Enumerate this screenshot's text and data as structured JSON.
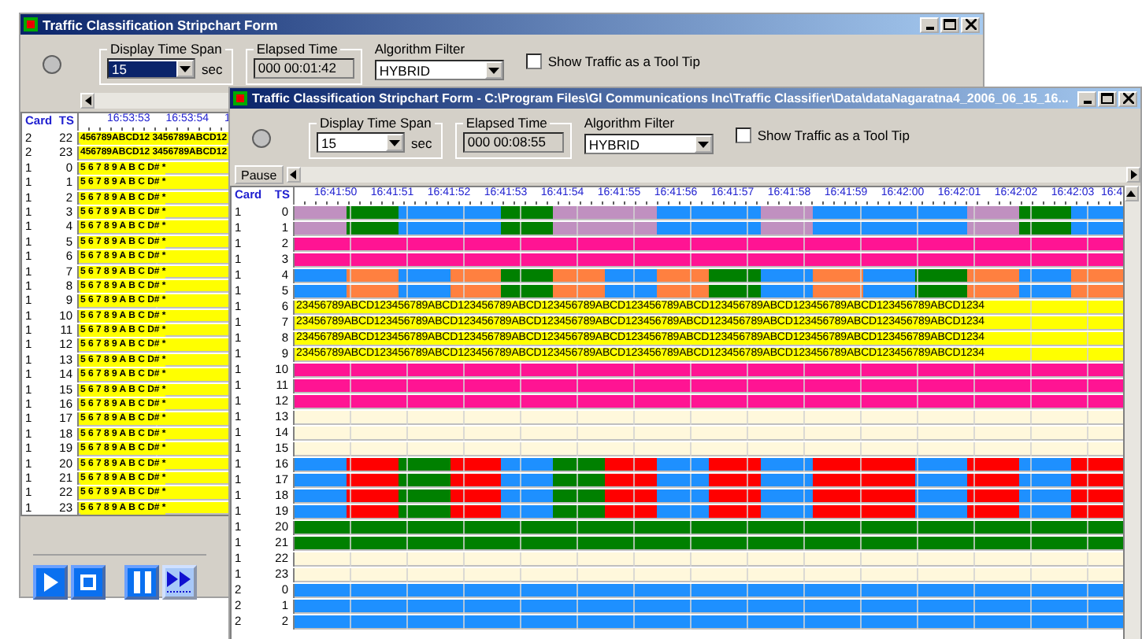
{
  "windows": [
    {
      "title": "Traffic Classification Stripchart Form",
      "time_span": {
        "legend": "Display Time Span",
        "value": "15",
        "highlighted": true,
        "unit": "sec"
      },
      "elapsed": {
        "legend": "Elapsed Time",
        "value": "000 00:01:42"
      },
      "algorithm": {
        "label": "Algorithm Filter",
        "value": "HYBRID"
      },
      "tooltip": {
        "label": "Show Traffic as a Tool Tip",
        "checked": false
      },
      "grid": {
        "columns": [
          "Card",
          "TS"
        ],
        "times": [
          "16:53:53",
          "16:53:54",
          "1"
        ],
        "rows": [
          {
            "card": "2",
            "ts": "22",
            "segments": [
              {
                "color": "#ffff00"
              }
            ],
            "text": "456789ABCD12 3456789ABCD12"
          },
          {
            "card": "2",
            "ts": "23",
            "segments": [
              {
                "color": "#ffff00"
              }
            ],
            "text": "456789ABCD12 3456789ABCD12"
          },
          {
            "card": "1",
            "ts": "0",
            "segments": [
              {
                "color": "#ffff00"
              }
            ],
            "text": "5 6 7 8 9 A B C D# *"
          },
          {
            "card": "1",
            "ts": "1",
            "segments": [
              {
                "color": "#ffff00"
              }
            ],
            "text": "5 6 7 8 9 A B C D# *"
          },
          {
            "card": "1",
            "ts": "2",
            "segments": [
              {
                "color": "#ffff00"
              }
            ],
            "text": "5 6 7 8 9 A B C D# *"
          },
          {
            "card": "1",
            "ts": "3",
            "segments": [
              {
                "color": "#ffff00"
              }
            ],
            "text": "5 6 7 8 9 A B C D# *"
          },
          {
            "card": "1",
            "ts": "4",
            "segments": [
              {
                "color": "#ffff00"
              }
            ],
            "text": "5 6 7 8 9 A B C D# *"
          },
          {
            "card": "1",
            "ts": "5",
            "segments": [
              {
                "color": "#ffff00"
              }
            ],
            "text": "5 6 7 8 9 A B C D# *"
          },
          {
            "card": "1",
            "ts": "6",
            "segments": [
              {
                "color": "#ffff00"
              }
            ],
            "text": "5 6 7 8 9 A B C D# *"
          },
          {
            "card": "1",
            "ts": "7",
            "segments": [
              {
                "color": "#ffff00"
              }
            ],
            "text": "5 6 7 8 9 A B C D# *"
          },
          {
            "card": "1",
            "ts": "8",
            "segments": [
              {
                "color": "#ffff00"
              }
            ],
            "text": "5 6 7 8 9 A B C D# *"
          },
          {
            "card": "1",
            "ts": "9",
            "segments": [
              {
                "color": "#ffff00"
              }
            ],
            "text": "5 6 7 8 9 A B C D# *"
          },
          {
            "card": "1",
            "ts": "10",
            "segments": [
              {
                "color": "#ffff00"
              }
            ],
            "text": "5 6 7 8 9 A B C D# *"
          },
          {
            "card": "1",
            "ts": "11",
            "segments": [
              {
                "color": "#ffff00"
              }
            ],
            "text": "5 6 7 8 9 A B C D# *"
          },
          {
            "card": "1",
            "ts": "12",
            "segments": [
              {
                "color": "#ffff00"
              }
            ],
            "text": "5 6 7 8 9 A B C D# *"
          },
          {
            "card": "1",
            "ts": "13",
            "segments": [
              {
                "color": "#ffff00"
              }
            ],
            "text": "5 6 7 8 9 A B C D# *"
          },
          {
            "card": "1",
            "ts": "14",
            "segments": [
              {
                "color": "#ffff00"
              }
            ],
            "text": "5 6 7 8 9 A B C D# *"
          },
          {
            "card": "1",
            "ts": "15",
            "segments": [
              {
                "color": "#ffff00"
              }
            ],
            "text": "5 6 7 8 9 A B C D# *"
          },
          {
            "card": "1",
            "ts": "16",
            "segments": [
              {
                "color": "#ffff00"
              }
            ],
            "text": "5 6 7 8 9 A B C D# *"
          },
          {
            "card": "1",
            "ts": "17",
            "segments": [
              {
                "color": "#ffff00"
              }
            ],
            "text": "5 6 7 8 9 A B C D# *"
          },
          {
            "card": "1",
            "ts": "18",
            "segments": [
              {
                "color": "#ffff00"
              }
            ],
            "text": "5 6 7 8 9 A B C D# *"
          },
          {
            "card": "1",
            "ts": "19",
            "segments": [
              {
                "color": "#ffff00"
              }
            ],
            "text": "5 6 7 8 9 A B C D# *"
          },
          {
            "card": "1",
            "ts": "20",
            "segments": [
              {
                "color": "#ffff00"
              }
            ],
            "text": "5 6 7 8 9 A B C D# *"
          },
          {
            "card": "1",
            "ts": "21",
            "segments": [
              {
                "color": "#ffff00"
              }
            ],
            "text": "5 6 7 8 9 A B C D# *"
          },
          {
            "card": "1",
            "ts": "22",
            "segments": [
              {
                "color": "#ffff00"
              }
            ],
            "text": "5 6 7 8 9 A B C D# *"
          },
          {
            "card": "1",
            "ts": "23",
            "segments": [
              {
                "color": "#ffff00"
              }
            ],
            "text": "5 6 7 8 9 A B C D# *"
          }
        ]
      },
      "transport": [
        {
          "kind": "play",
          "selected": false
        },
        {
          "kind": "stop",
          "selected": false
        },
        {
          "kind": "pause",
          "selected": false
        },
        {
          "kind": "fast-forward",
          "selected": true
        }
      ]
    },
    {
      "title": "Traffic Classification Stripchart Form - C:\\Program Files\\Gl Communications Inc\\Traffic Classifier\\Data\\dataNagaratna4_2006_06_15_16...",
      "time_span": {
        "legend": "Display Time Span",
        "value": "15",
        "highlighted": false,
        "unit": "sec"
      },
      "elapsed": {
        "legend": "Elapsed Time",
        "value": "000 00:08:55"
      },
      "algorithm": {
        "label": "Algorithm Filter",
        "value": "HYBRID"
      },
      "tooltip": {
        "label": "Show Traffic as a Tool Tip",
        "checked": false
      },
      "pause_label": "Pause",
      "grid": {
        "columns": [
          "Card",
          "TS"
        ],
        "times": [
          "16:41:50",
          "16:41:51",
          "16:41:52",
          "16:41:53",
          "16:41:54",
          "16:41:55",
          "16:41:56",
          "16:41:57",
          "16:41:58",
          "16:41:59",
          "16:42:00",
          "16:42:01",
          "16:42:02",
          "16:42:03",
          "16:4"
        ],
        "rows": [
          {
            "card": "1",
            "ts": "0",
            "segments": [
              {
                "color": "#c090c0"
              },
              {
                "color": "#008000"
              },
              {
                "color": "#1e90ff"
              },
              {
                "color": "#1e90ff"
              },
              {
                "color": "#008000"
              },
              {
                "color": "#c090c0"
              },
              {
                "color": "#c090c0"
              },
              {
                "color": "#1e90ff"
              },
              {
                "color": "#1e90ff"
              },
              {
                "color": "#c090c0"
              },
              {
                "color": "#1e90ff"
              },
              {
                "color": "#1e90ff"
              },
              {
                "color": "#1e90ff"
              },
              {
                "color": "#c090c0"
              },
              {
                "color": "#008000"
              },
              {
                "color": "#1e90ff"
              }
            ]
          },
          {
            "card": "1",
            "ts": "1",
            "segments": [
              {
                "color": "#c090c0"
              },
              {
                "color": "#008000"
              },
              {
                "color": "#1e90ff"
              },
              {
                "color": "#1e90ff"
              },
              {
                "color": "#008000"
              },
              {
                "color": "#c090c0"
              },
              {
                "color": "#c090c0"
              },
              {
                "color": "#1e90ff"
              },
              {
                "color": "#1e90ff"
              },
              {
                "color": "#c090c0"
              },
              {
                "color": "#1e90ff"
              },
              {
                "color": "#1e90ff"
              },
              {
                "color": "#1e90ff"
              },
              {
                "color": "#c090c0"
              },
              {
                "color": "#008000"
              },
              {
                "color": "#1e90ff"
              }
            ]
          },
          {
            "card": "1",
            "ts": "2",
            "segments": [
              {
                "color": "#ff1493"
              }
            ]
          },
          {
            "card": "1",
            "ts": "3",
            "segments": [
              {
                "color": "#ff1493"
              }
            ]
          },
          {
            "card": "1",
            "ts": "4",
            "segments": [
              {
                "color": "#1e90ff"
              },
              {
                "color": "#ff8040"
              },
              {
                "color": "#1e90ff"
              },
              {
                "color": "#ff8040"
              },
              {
                "color": "#008000"
              },
              {
                "color": "#ff8040"
              },
              {
                "color": "#1e90ff"
              },
              {
                "color": "#ff8040"
              },
              {
                "color": "#008000"
              },
              {
                "color": "#1e90ff"
              },
              {
                "color": "#ff8040"
              },
              {
                "color": "#1e90ff"
              },
              {
                "color": "#008000"
              },
              {
                "color": "#ff8040"
              },
              {
                "color": "#1e90ff"
              },
              {
                "color": "#ff8040"
              }
            ]
          },
          {
            "card": "1",
            "ts": "5",
            "segments": [
              {
                "color": "#1e90ff"
              },
              {
                "color": "#ff8040"
              },
              {
                "color": "#1e90ff"
              },
              {
                "color": "#ff8040"
              },
              {
                "color": "#008000"
              },
              {
                "color": "#ff8040"
              },
              {
                "color": "#1e90ff"
              },
              {
                "color": "#ff8040"
              },
              {
                "color": "#008000"
              },
              {
                "color": "#1e90ff"
              },
              {
                "color": "#ff8040"
              },
              {
                "color": "#1e90ff"
              },
              {
                "color": "#008000"
              },
              {
                "color": "#ff8040"
              },
              {
                "color": "#1e90ff"
              },
              {
                "color": "#ff8040"
              }
            ]
          },
          {
            "card": "1",
            "ts": "6",
            "segments": [
              {
                "color": "#ffff00"
              }
            ],
            "text": "23456789ABCD123456789ABCD123456789ABCD123456789ABCD123456789ABCD123456789ABCD123456789ABCD123456789ABCD1234"
          },
          {
            "card": "1",
            "ts": "7",
            "segments": [
              {
                "color": "#ffff00"
              }
            ],
            "text": "23456789ABCD123456789ABCD123456789ABCD123456789ABCD123456789ABCD123456789ABCD123456789ABCD123456789ABCD1234"
          },
          {
            "card": "1",
            "ts": "8",
            "segments": [
              {
                "color": "#ffff00"
              }
            ],
            "text": "23456789ABCD123456789ABCD123456789ABCD123456789ABCD123456789ABCD123456789ABCD123456789ABCD123456789ABCD1234"
          },
          {
            "card": "1",
            "ts": "9",
            "segments": [
              {
                "color": "#ffff00"
              }
            ],
            "text": "23456789ABCD123456789ABCD123456789ABCD123456789ABCD123456789ABCD123456789ABCD123456789ABCD123456789ABCD1234"
          },
          {
            "card": "1",
            "ts": "10",
            "segments": [
              {
                "color": "#ff1493"
              }
            ]
          },
          {
            "card": "1",
            "ts": "11",
            "segments": [
              {
                "color": "#ff1493"
              }
            ]
          },
          {
            "card": "1",
            "ts": "12",
            "segments": [
              {
                "color": "#ff1493"
              }
            ]
          },
          {
            "card": "1",
            "ts": "13",
            "segments": [
              {
                "color": "#fff8dc"
              }
            ]
          },
          {
            "card": "1",
            "ts": "14",
            "segments": [
              {
                "color": "#fff8dc"
              }
            ]
          },
          {
            "card": "1",
            "ts": "15",
            "segments": [
              {
                "color": "#fff8dc"
              }
            ]
          },
          {
            "card": "1",
            "ts": "16",
            "segments": [
              {
                "color": "#1e90ff"
              },
              {
                "color": "#ff0000"
              },
              {
                "color": "#008000"
              },
              {
                "color": "#ff0000"
              },
              {
                "color": "#1e90ff"
              },
              {
                "color": "#008000"
              },
              {
                "color": "#ff0000"
              },
              {
                "color": "#1e90ff"
              },
              {
                "color": "#ff0000"
              },
              {
                "color": "#1e90ff"
              },
              {
                "color": "#ff0000"
              },
              {
                "color": "#ff0000"
              },
              {
                "color": "#1e90ff"
              },
              {
                "color": "#ff0000"
              },
              {
                "color": "#1e90ff"
              },
              {
                "color": "#ff0000"
              }
            ]
          },
          {
            "card": "1",
            "ts": "17",
            "segments": [
              {
                "color": "#1e90ff"
              },
              {
                "color": "#ff0000"
              },
              {
                "color": "#008000"
              },
              {
                "color": "#ff0000"
              },
              {
                "color": "#1e90ff"
              },
              {
                "color": "#008000"
              },
              {
                "color": "#ff0000"
              },
              {
                "color": "#1e90ff"
              },
              {
                "color": "#ff0000"
              },
              {
                "color": "#1e90ff"
              },
              {
                "color": "#ff0000"
              },
              {
                "color": "#ff0000"
              },
              {
                "color": "#1e90ff"
              },
              {
                "color": "#ff0000"
              },
              {
                "color": "#1e90ff"
              },
              {
                "color": "#ff0000"
              }
            ]
          },
          {
            "card": "1",
            "ts": "18",
            "segments": [
              {
                "color": "#1e90ff"
              },
              {
                "color": "#ff0000"
              },
              {
                "color": "#008000"
              },
              {
                "color": "#ff0000"
              },
              {
                "color": "#1e90ff"
              },
              {
                "color": "#008000"
              },
              {
                "color": "#ff0000"
              },
              {
                "color": "#1e90ff"
              },
              {
                "color": "#ff0000"
              },
              {
                "color": "#1e90ff"
              },
              {
                "color": "#ff0000"
              },
              {
                "color": "#ff0000"
              },
              {
                "color": "#1e90ff"
              },
              {
                "color": "#ff0000"
              },
              {
                "color": "#1e90ff"
              },
              {
                "color": "#ff0000"
              }
            ]
          },
          {
            "card": "1",
            "ts": "19",
            "segments": [
              {
                "color": "#1e90ff"
              },
              {
                "color": "#ff0000"
              },
              {
                "color": "#008000"
              },
              {
                "color": "#ff0000"
              },
              {
                "color": "#1e90ff"
              },
              {
                "color": "#008000"
              },
              {
                "color": "#ff0000"
              },
              {
                "color": "#1e90ff"
              },
              {
                "color": "#ff0000"
              },
              {
                "color": "#1e90ff"
              },
              {
                "color": "#ff0000"
              },
              {
                "color": "#ff0000"
              },
              {
                "color": "#1e90ff"
              },
              {
                "color": "#ff0000"
              },
              {
                "color": "#1e90ff"
              },
              {
                "color": "#ff0000"
              }
            ]
          },
          {
            "card": "1",
            "ts": "20",
            "segments": [
              {
                "color": "#008000"
              }
            ]
          },
          {
            "card": "1",
            "ts": "21",
            "segments": [
              {
                "color": "#008000"
              }
            ]
          },
          {
            "card": "1",
            "ts": "22",
            "segments": [
              {
                "color": "#fff8dc"
              }
            ]
          },
          {
            "card": "1",
            "ts": "23",
            "segments": [
              {
                "color": "#fff8dc"
              }
            ]
          },
          {
            "card": "2",
            "ts": "0",
            "segments": [
              {
                "color": "#1e90ff"
              }
            ]
          },
          {
            "card": "2",
            "ts": "1",
            "segments": [
              {
                "color": "#1e90ff"
              }
            ]
          },
          {
            "card": "2",
            "ts": "2",
            "segments": [
              {
                "color": "#1e90ff"
              }
            ]
          }
        ]
      }
    }
  ]
}
